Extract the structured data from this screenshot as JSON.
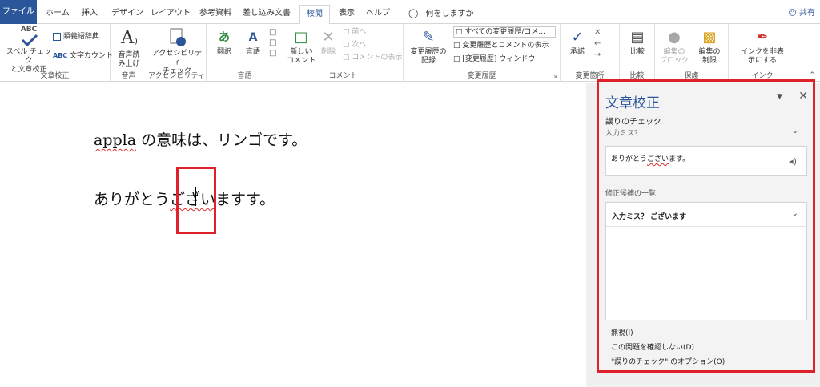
{
  "tabs": [
    {
      "label": "ファイル"
    },
    {
      "label": "ホーム"
    },
    {
      "label": "挿入"
    },
    {
      "label": "デザイン"
    },
    {
      "label": "レイアウト"
    },
    {
      "label": "参考資料"
    },
    {
      "label": "差し込み文書"
    },
    {
      "label": "校閲"
    },
    {
      "label": "表示"
    },
    {
      "label": "ヘルプ"
    }
  ],
  "tell_me": "何をしますか",
  "share": "共有",
  "ribbon": {
    "proofing": {
      "group": "文章校正",
      "spell_line1": "スペル チェック",
      "spell_line2": "と文章校正",
      "abc": "ABC",
      "thesaurus": "類義語辞典",
      "wordcount": "文字カウント"
    },
    "speech": {
      "group": "音声",
      "read_line1": "音声読",
      "read_line2": "み上げ"
    },
    "accessibility": {
      "group": "アクセシビリティ",
      "check_line1": "アクセシビリティ",
      "check_line2": "チェック"
    },
    "language": {
      "group": "言語",
      "translate": "翻訳",
      "language": "言語"
    },
    "comments": {
      "group": "コメント",
      "new_line1": "新しい",
      "new_line2": "コメント",
      "delete": "削除",
      "prev": "前へ",
      "next": "次へ",
      "show": "コメントの表示"
    },
    "tracking": {
      "group": "変更履歴",
      "track_line1": "変更履歴の",
      "track_line2": "記録",
      "all_markup": "すべての変更履歴/コメ...",
      "show_markup": "変更履歴とコメントの表示",
      "pane": "[変更履歴] ウィンドウ"
    },
    "changes": {
      "group": "変更箇所",
      "accept": "承諾"
    },
    "compare": {
      "group": "比較",
      "compare": "比較"
    },
    "protect": {
      "group": "保護",
      "block_line1": "編集の",
      "block_line2": "ブロック",
      "restrict_line1": "編集の",
      "restrict_line2": "制限"
    },
    "ink": {
      "group": "インク",
      "hide_line1": "インクを非表",
      "hide_line2": "示にする"
    }
  },
  "document": {
    "line1_word": "appla",
    "line1_rest": " の意味は、リンゴです。",
    "line2_pre": "ありがとう",
    "line2_err": "ござい",
    "line2_mid": "ます",
    "line2_tail": "す。"
  },
  "pane": {
    "title": "文章校正",
    "section": "誤りのチェック",
    "subsection": "入力ミス？",
    "context_pre": "ありがとう",
    "context_err": "ござい",
    "context_post": "ます。",
    "suggestions_label": "修正候補の一覧",
    "suggestion": "入力ミス？ ございます",
    "ignore": "無視(I)",
    "dont_check": "この問題を確認しない(D)",
    "options": "\"誤りのチェック\" のオプション(O)"
  }
}
